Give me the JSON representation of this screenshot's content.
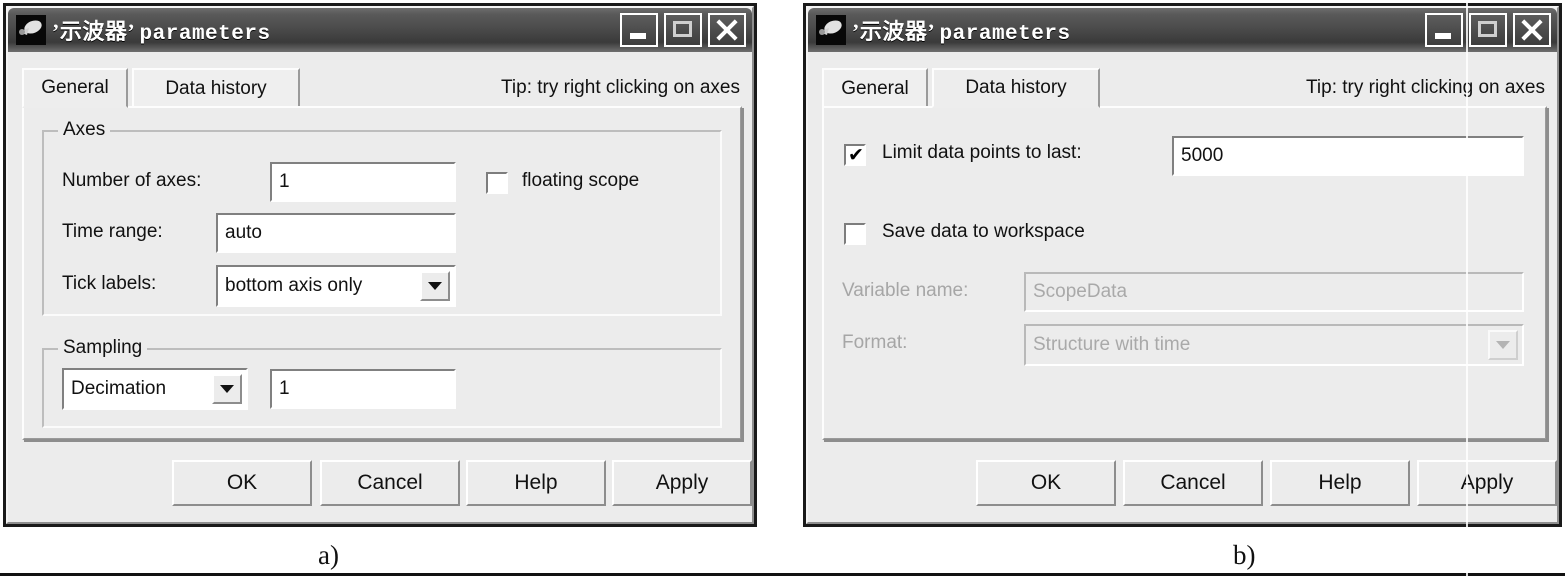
{
  "window_a": {
    "title_quoted": "’示波器’",
    "title_suffix": "parameters",
    "icon": "scope-icon",
    "titlebar_buttons": [
      {
        "name": "minimize",
        "glyph": "_"
      },
      {
        "name": "maximize",
        "glyph": "□"
      },
      {
        "name": "close",
        "glyph": "✕"
      }
    ],
    "tabs": [
      {
        "label": "General",
        "active": true
      },
      {
        "label": "Data history",
        "active": false
      }
    ],
    "tip": "Tip:  try right clicking on axes",
    "groups": [
      {
        "title": "Axes",
        "fields": [
          {
            "label": "Number of axes:",
            "value": "1",
            "type": "text"
          },
          {
            "label": "Time range:",
            "value": "auto",
            "type": "text"
          },
          {
            "label": "Tick labels:",
            "value": "bottom axis only",
            "type": "combo"
          }
        ],
        "checkbox": {
          "label": "floating scope",
          "checked": false
        }
      },
      {
        "title": "Sampling",
        "mode": "Decimation",
        "value": "1"
      }
    ],
    "buttons": [
      "OK",
      "Cancel",
      "Help",
      "Apply"
    ]
  },
  "window_b": {
    "title_quoted": "’示波器’",
    "title_suffix": "parameters",
    "icon": "scope-icon",
    "titlebar_buttons": [
      {
        "name": "minimize",
        "glyph": "_"
      },
      {
        "name": "maximize",
        "glyph": "□"
      },
      {
        "name": "close",
        "glyph": "✕"
      }
    ],
    "tabs": [
      {
        "label": "General",
        "active": false
      },
      {
        "label": "Data history",
        "active": true
      }
    ],
    "tip": "Tip:  try right clicking on axes",
    "limit": {
      "label": "Limit data points to last:",
      "checked": true,
      "value": "5000"
    },
    "save": {
      "label": "Save data to workspace",
      "checked": false
    },
    "variable": {
      "label": "Variable name:",
      "value": "ScopeData",
      "enabled": false
    },
    "format": {
      "label": "Format:",
      "value": "Structure with time",
      "enabled": false
    },
    "buttons": [
      "OK",
      "Cancel",
      "Help",
      "Apply"
    ]
  },
  "captions": {
    "a": "a)",
    "b": "b)"
  },
  "colors": {
    "face": "#ececec",
    "field": "#ffffff",
    "text": "#111111",
    "disabled_text": "#a9a9a9",
    "titlebar_dark": "#3a3a3a",
    "frame": "#1a1a1a"
  }
}
